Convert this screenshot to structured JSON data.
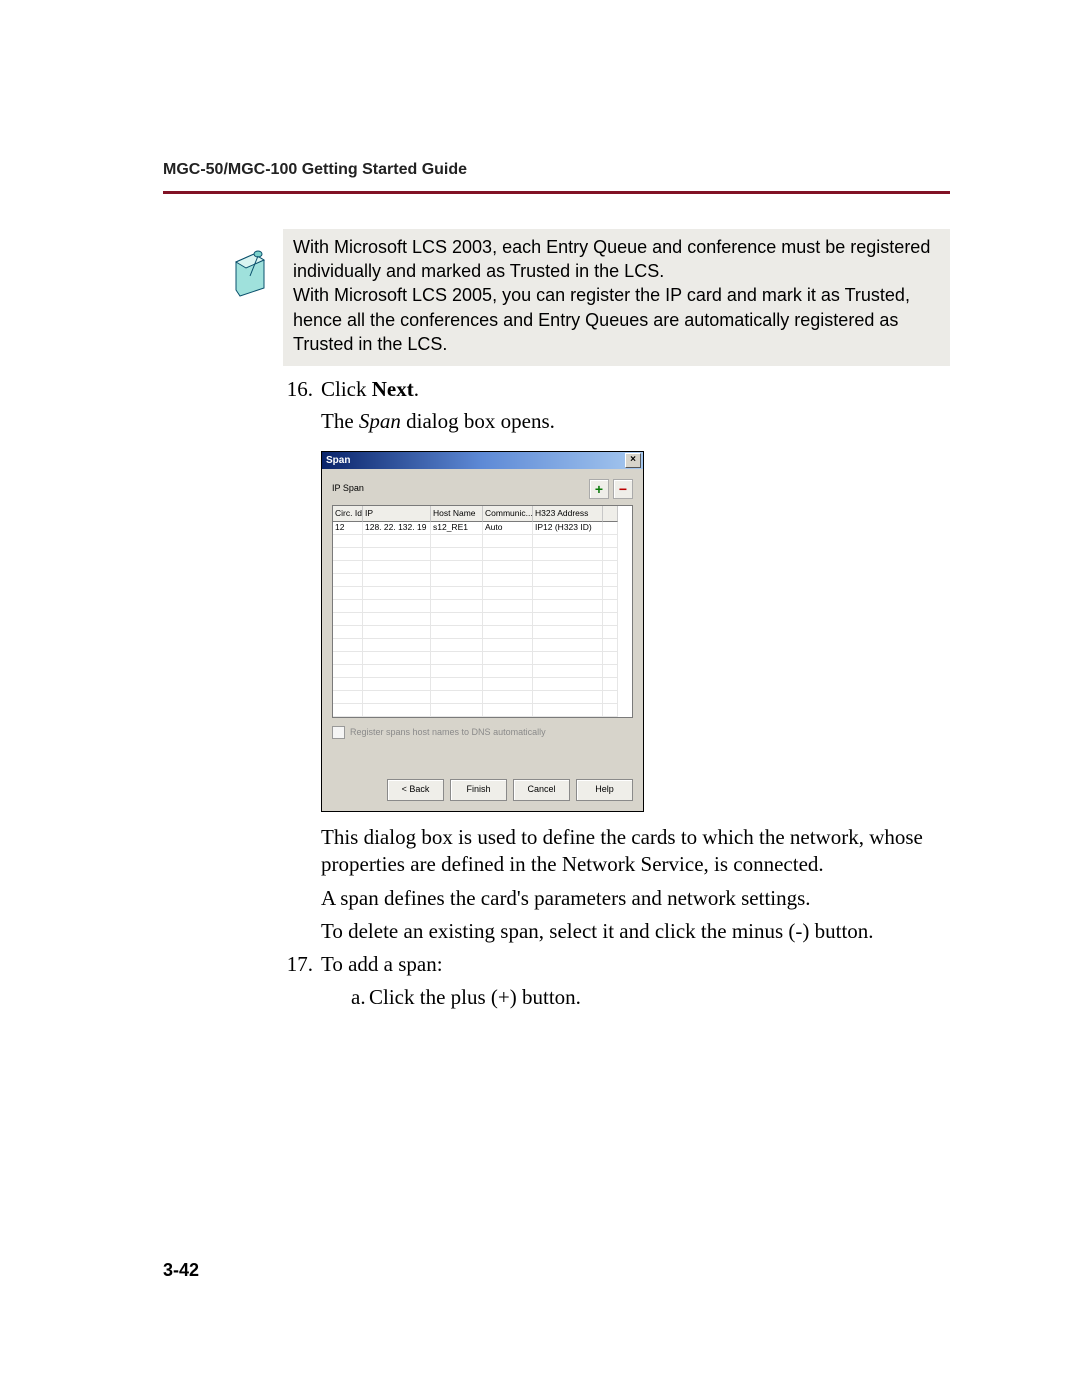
{
  "header": "MGC-50/MGC-100 Getting Started Guide",
  "note": "With Microsoft LCS 2003, each Entry Queue and conference must be registered individually and marked as Trusted in the LCS.\nWith Microsoft LCS 2005, you can register the IP card and mark it as Trusted, hence all the conferences and Entry Queues are automatically registered as Trusted in the LCS.",
  "steps": {
    "s16": {
      "num": "16.",
      "click_prefix": "Click ",
      "click_bold": "Next",
      "click_suffix": ".",
      "sub_prefix": "The ",
      "sub_ital": "Span",
      "sub_suffix": " dialog box opens."
    },
    "s17": {
      "num": "17.",
      "text": "To add a span:",
      "a": {
        "letter": "a.",
        "text": "Click the plus (+) button."
      }
    }
  },
  "dialog": {
    "title": "Span",
    "close": "×",
    "section": "IP Span",
    "plus": "+",
    "minus": "−",
    "columns": [
      "Circ. Id",
      "IP",
      "Host Name",
      "Communic...",
      "H323 Address",
      ""
    ],
    "row": {
      "circ": "12",
      "ip": "128. 22. 132. 19",
      "host": "s12_RE1",
      "comm": "Auto",
      "h323": "IP12 (H323 ID)"
    },
    "checkbox": "Register spans host names to DNS automatically",
    "buttons": {
      "back": "< Back",
      "finish": "Finish",
      "cancel": "Cancel",
      "help": "Help"
    }
  },
  "below": {
    "p1": "This dialog box is used to define the cards to which the network, whose properties are defined in the Network Service, is connected.",
    "p2": "A span defines the card's parameters and network settings.",
    "p3": "To delete an existing span, select it and click the minus (-) button."
  },
  "page_num": "3-42"
}
